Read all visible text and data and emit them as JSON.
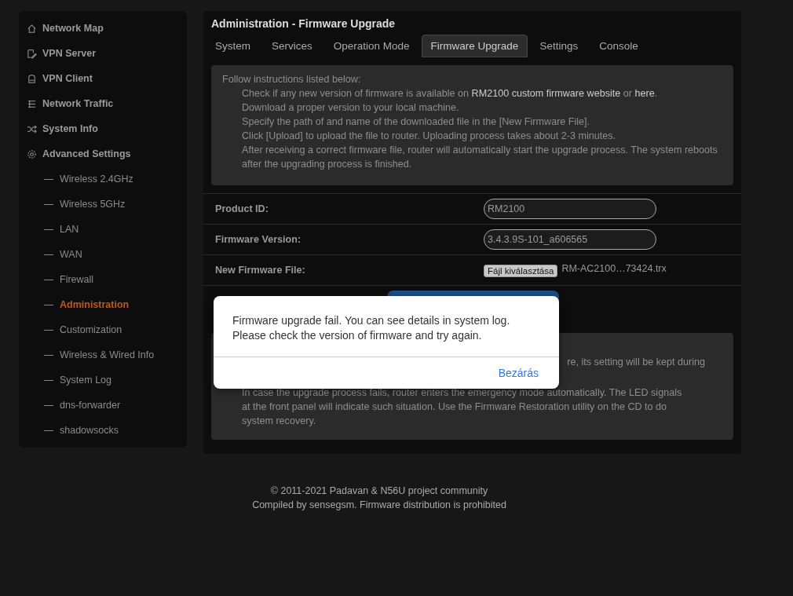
{
  "sidebar": {
    "items": [
      {
        "label": "Network Map",
        "kind": "main",
        "selected": false
      },
      {
        "label": "VPN Server",
        "kind": "main",
        "selected": false
      },
      {
        "label": "VPN Client",
        "kind": "main",
        "selected": false
      },
      {
        "label": "Network Traffic",
        "kind": "main",
        "selected": false
      },
      {
        "label": "System Info",
        "kind": "main",
        "selected": false
      },
      {
        "label": "Advanced Settings",
        "kind": "main",
        "selected": false
      },
      {
        "label": "Wireless 2.4GHz",
        "kind": "sub",
        "selected": false
      },
      {
        "label": "Wireless 5GHz",
        "kind": "sub",
        "selected": false
      },
      {
        "label": "LAN",
        "kind": "sub",
        "selected": false
      },
      {
        "label": "WAN",
        "kind": "sub",
        "selected": false
      },
      {
        "label": "Firewall",
        "kind": "sub",
        "selected": false
      },
      {
        "label": "Administration",
        "kind": "sub",
        "selected": true
      },
      {
        "label": "Customization",
        "kind": "sub",
        "selected": false
      },
      {
        "label": "Wireless & Wired Info",
        "kind": "sub",
        "selected": false
      },
      {
        "label": "System Log",
        "kind": "sub",
        "selected": false
      },
      {
        "label": "dns-forwarder",
        "kind": "sub",
        "selected": false
      },
      {
        "label": "shadowsocks",
        "kind": "sub",
        "selected": false
      }
    ]
  },
  "page_title": "Administration - Firmware Upgrade",
  "tabs": [
    {
      "label": "System",
      "selected": false
    },
    {
      "label": "Services",
      "selected": false
    },
    {
      "label": "Operation Mode",
      "selected": false
    },
    {
      "label": "Firmware Upgrade",
      "selected": true
    },
    {
      "label": "Settings",
      "selected": false
    },
    {
      "label": "Console",
      "selected": false
    }
  ],
  "instructions": {
    "intro": "Follow instructions listed below:",
    "steps": [
      {
        "text": "Check if any new version of firmware is available on ",
        "link1": "RM2100 custom firmware website",
        "middle": " or ",
        "link2": "here",
        "end": "."
      },
      {
        "text": "Download a proper version to your local machine."
      },
      {
        "text": "Specify the path of and name of the downloaded file in the [New Firmware File]."
      },
      {
        "text": "Click [Upload] to upload the file to router. Uploading process takes about 2-3 minutes."
      },
      {
        "text": "After receiving a correct firmware file, router will automatically start the upgrade process. The system reboots after the upgrading process is finished."
      }
    ]
  },
  "fields": [
    {
      "label": "Product ID:",
      "kind": "text",
      "value": "RM2100"
    },
    {
      "label": "Firmware Version:",
      "kind": "text",
      "value": "3.4.3.9S-101_a606565"
    },
    {
      "label": "New Firmware File:",
      "kind": "file",
      "button": "Fájl kiválasztása",
      "value": "RM-AC2100…73424.trx"
    }
  ],
  "note": {
    "lines": [
      "re, its setting will be kept during",
      "In case the upgrade process fails, router enters the emergency mode automatically. The LED signals",
      "at the front panel will indicate such situation. Use the Firmware Restoration utility on the CD to do",
      "system recovery."
    ]
  },
  "dialog": {
    "message": "Firmware upgrade fail. You can see details in system log. Please check the version of firmware and try again.",
    "button": "Bezárás"
  },
  "footer": [
    "© 2011-2021 Padavan & N56U project community",
    "Compiled by sensegsm. Firmware distribution is prohibited"
  ]
}
